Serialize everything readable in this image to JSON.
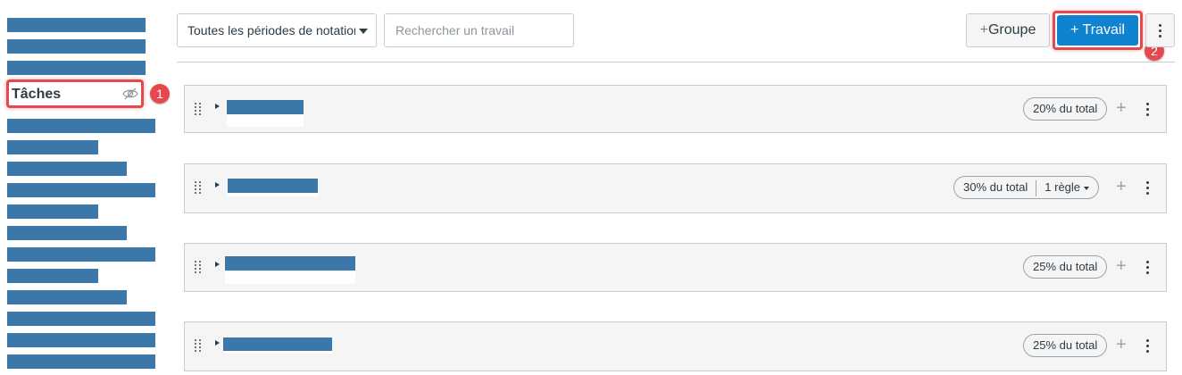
{
  "sidebar": {
    "tasks_label": "Tâches",
    "tasks_icon": "eye-slash-icon",
    "callout_1": "1"
  },
  "toolbar": {
    "grading_period_value": "Toutes les périodes de notation",
    "search_placeholder": "Rechercher un travail",
    "add_group_plus": "+",
    "add_group_label": "Groupe",
    "add_assignment_plus": "+",
    "add_assignment_label": "Travail",
    "callout_2": "2",
    "more_icon": "kebab-icon"
  },
  "groups": [
    {
      "weight_label": "20% du total"
    },
    {
      "weight_label": "30% du total",
      "rules_label": "1 règle"
    },
    {
      "weight_label": "25% du total"
    },
    {
      "weight_label": "25% du total"
    }
  ],
  "colors": {
    "redacted": "#3b77a8",
    "primary_button": "#0f82d0",
    "highlight": "#e5484d"
  }
}
